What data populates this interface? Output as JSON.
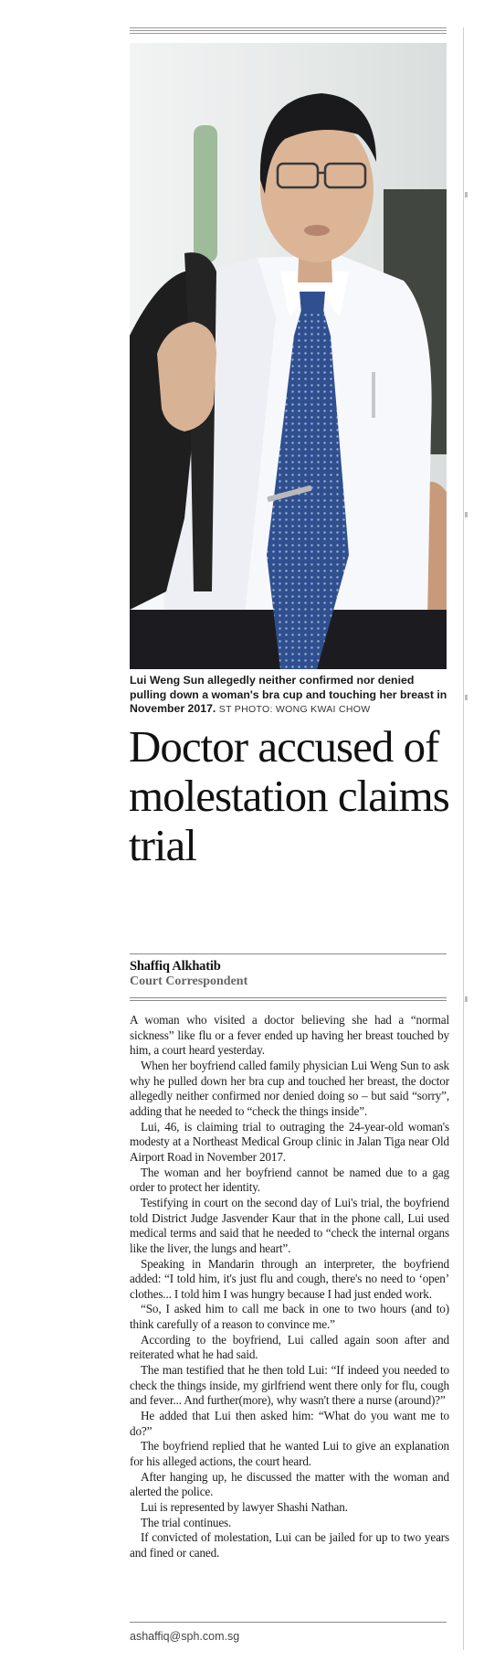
{
  "article": {
    "caption_text": "Lui Weng Sun allegedly neither confirmed nor denied pulling down a woman's bra cup and touching her breast in November 2017.",
    "caption_credit": "ST PHOTO: WONG KWAI CHOW",
    "headline": "Doctor accused of molestation claims trial",
    "byline_name": "Shaffiq Alkhatib",
    "byline_role": "Court Correspondent",
    "paragraphs": [
      "A woman who visited a doctor believing she had a “normal sickness” like flu or a fever ended up having her breast touched by him, a court heard yesterday.",
      "When her boyfriend called family physician Lui Weng Sun to ask why he pulled down her bra cup and touched her breast, the doctor allegedly neither confirmed nor denied doing so – but said “sorry”, adding that he needed to “check the things inside”.",
      "Lui, 46, is claiming trial to outraging the 24-year-old woman's modesty at a Northeast Medical Group clinic in Jalan Tiga near Old Airport Road in November 2017.",
      "The woman and her boyfriend cannot be named due to a gag order to protect her identity.",
      "Testifying in court on the second day of Lui's trial, the boyfriend told District Judge Jasvender Kaur that in the phone call, Lui used medical terms and said that he needed to “check the internal organs like the liver, the lungs and heart”.",
      "Speaking in Mandarin through an interpreter, the boyfriend added: “I told him, it's just flu and cough, there's no need to ‘open’ clothes... I told him I was hungry because I had just ended work.",
      "“So, I asked him to call me back in one to two hours (and to) think carefully of a reason to convince me.”",
      "According to the boyfriend, Lui called again soon after and reiterated what he had said.",
      "The man testified that he then told Lui: “If indeed you needed to check the things inside, my girlfriend went there only for flu, cough and fever... And further(more), why wasn't there a nurse (around)?”",
      "He added that Lui then asked him: “What do you want me to do?”",
      "The boyfriend replied that he wanted Lui to give an explanation for his alleged actions, the court heard.",
      "After hanging up, he discussed the matter with the woman and alerted the police.",
      "Lui is represented by lawyer Shashi Nathan.",
      "The trial continues.",
      "If convicted of molestation, Lui can be jailed for up to two years and fined or caned."
    ],
    "email": "ashaffiq@sph.com.sg"
  }
}
